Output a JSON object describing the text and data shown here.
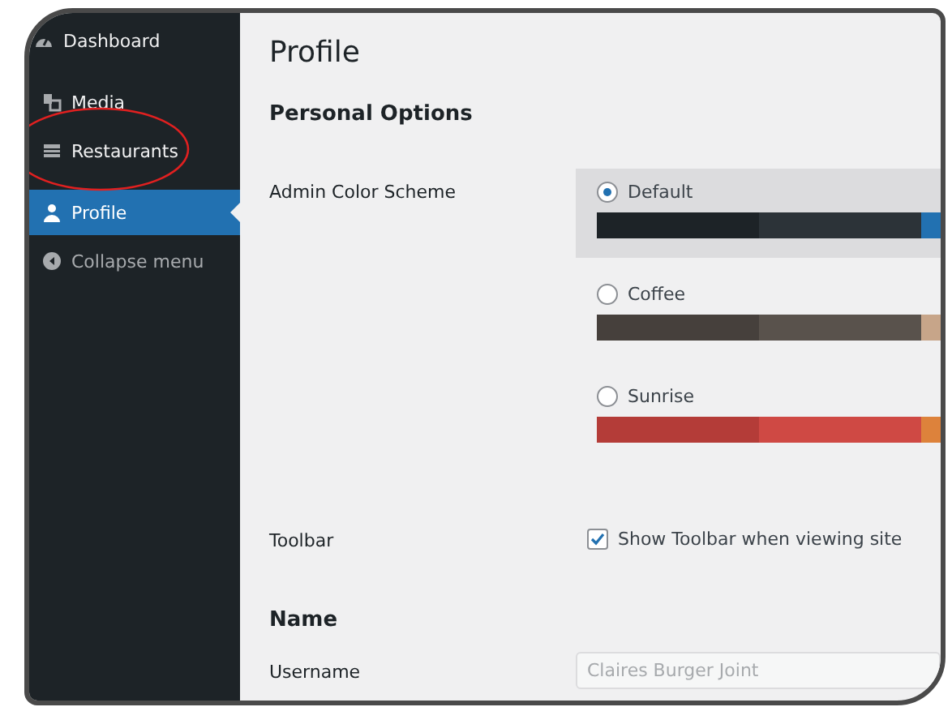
{
  "sidebar": {
    "items": [
      {
        "label": "Dashboard",
        "selected": false
      },
      {
        "label": "Media",
        "selected": false
      },
      {
        "label": "Restaurants",
        "selected": false
      },
      {
        "label": "Profile",
        "selected": true
      },
      {
        "label": "Collapse menu",
        "selected": false
      }
    ]
  },
  "page": {
    "title": "Profile",
    "section": "Personal Options",
    "color_scheme": {
      "label": "Admin Color Scheme",
      "options": [
        {
          "label": "Default",
          "selected": true
        },
        {
          "label": "Coffee",
          "selected": false
        },
        {
          "label": "Sunrise",
          "selected": false
        }
      ]
    },
    "toolbar": {
      "label": "Toolbar",
      "option": "Show Toolbar when viewing site",
      "checked": true
    },
    "name_section": "Name",
    "username": {
      "label": "Username",
      "value": "Claires Burger Joint",
      "disabled": true
    }
  }
}
